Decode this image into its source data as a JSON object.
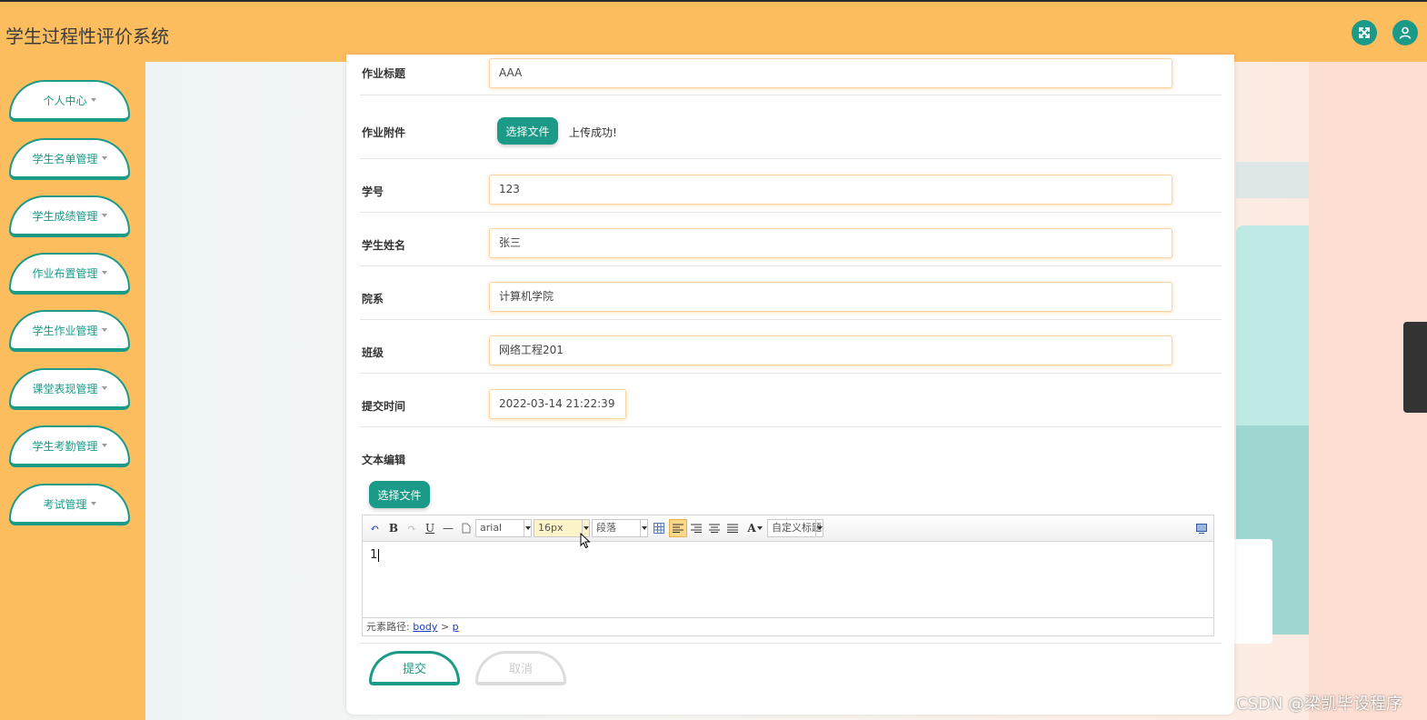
{
  "app": {
    "title": "学生过程性评价系统"
  },
  "header": {
    "icons": [
      "fullscreen-icon",
      "user-icon"
    ],
    "accent": "#fcbd5f",
    "brand": "#1b9a88"
  },
  "sidebar": {
    "items": [
      {
        "label": "个人中心"
      },
      {
        "label": "学生名单管理"
      },
      {
        "label": "学生成绩管理"
      },
      {
        "label": "作业布置管理"
      },
      {
        "label": "学生作业管理"
      },
      {
        "label": "课堂表现管理"
      },
      {
        "label": "学生考勤管理"
      },
      {
        "label": "考试管理"
      }
    ]
  },
  "form": {
    "title": {
      "label": "作业标题",
      "value": "AAA"
    },
    "attachment": {
      "label": "作业附件",
      "button": "选择文件",
      "status": "上传成功!"
    },
    "student_id": {
      "label": "学号",
      "value": "123"
    },
    "student_name": {
      "label": "学生姓名",
      "value": "张三"
    },
    "department": {
      "label": "院系",
      "value": "计算机学院"
    },
    "class": {
      "label": "班级",
      "value": "网络工程201"
    },
    "submit_time": {
      "label": "提交时间",
      "value": "2022-03-14 21:22:39"
    },
    "editor": {
      "label": "文本编辑",
      "choose_button": "选择文件",
      "font_family": "arial",
      "font_size": "16px",
      "paragraph": "段落",
      "custom_heading": "自定义标题",
      "content": "1",
      "path_label": "元素路径:",
      "path_body": "body",
      "path_sep": ">",
      "path_p": "p"
    },
    "submit_button": "提交",
    "cancel_button": "取消"
  },
  "watermark": "CSDN @梁凯毕设程序"
}
